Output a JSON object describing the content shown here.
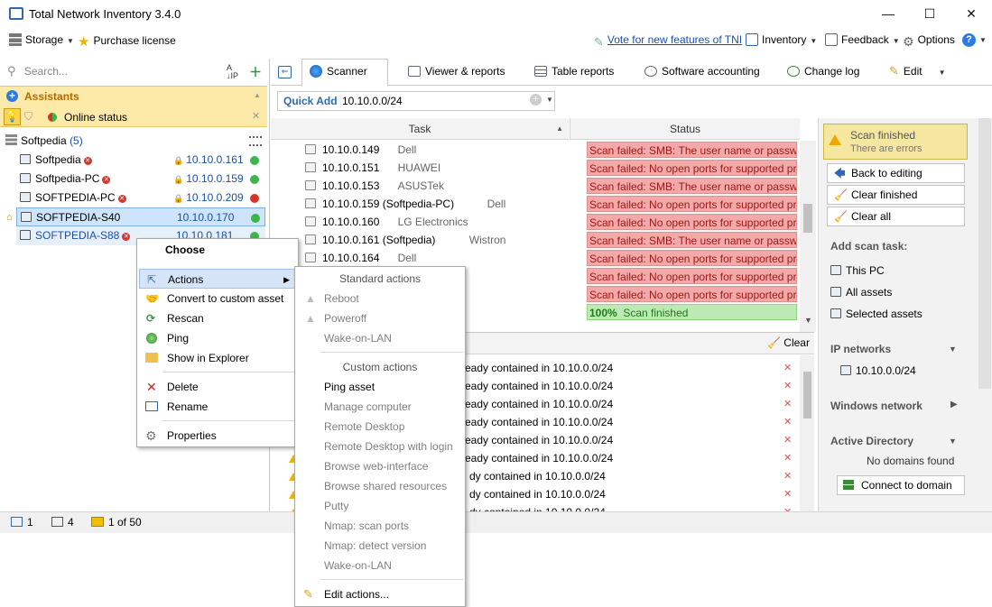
{
  "window": {
    "title": "Total Network Inventory 3.4.0",
    "min": "—",
    "max": "☐",
    "close": "✕"
  },
  "menu": {
    "storage": "Storage",
    "purchase": "Purchase license",
    "vote": "Vote for new features of TNI",
    "inventory": "Inventory",
    "feedback": "Feedback",
    "options": "Options",
    "help": "?"
  },
  "left": {
    "search_placeholder": "Search...",
    "assistants_title": "Assistants",
    "online_status": "Online status",
    "group": {
      "name": "Softpedia",
      "count": "(5)"
    },
    "hosts": [
      {
        "name": "Softpedia",
        "ip": "10.10.0.161",
        "color": "#3cb54a"
      },
      {
        "name": "Softpedia-PC",
        "ip": "10.10.0.159",
        "color": "#3cb54a"
      },
      {
        "name": "SOFTPEDIA-PC",
        "ip": "10.10.0.209",
        "color": "#d9342b"
      },
      {
        "name": "SOFTPEDIA-S40",
        "ip": "10.10.0.170",
        "color": "#3cb54a"
      },
      {
        "name": "SOFTPEDIA-S88",
        "ip": "10.10.0.181",
        "color": "#3cb54a"
      }
    ]
  },
  "tabs": {
    "scanner": "Scanner",
    "viewer": "Viewer & reports",
    "table": "Table reports",
    "software": "Software accounting",
    "changelog": "Change log",
    "edit": "Edit"
  },
  "quickadd": {
    "label": "Quick Add",
    "value": "10.10.0.0/24"
  },
  "grid": {
    "col_task": "Task",
    "col_status": "Status",
    "rows": [
      {
        "ip": "10.10.0.149",
        "vendor": "Dell",
        "status": "Scan failed: SMB: The user name or password is",
        "ok": false
      },
      {
        "ip": "10.10.0.151",
        "vendor": "HUAWEI",
        "status": "Scan failed: No open ports for supported protoc",
        "ok": false
      },
      {
        "ip": "10.10.0.153",
        "vendor": "ASUSTek",
        "status": "Scan failed: SMB: The user name or password is",
        "ok": false
      },
      {
        "ip": "10.10.0.159 (Softpedia-PC)",
        "vendor": "Dell",
        "status": "Scan failed: No open ports for supported protoc",
        "ok": false
      },
      {
        "ip": "10.10.0.160",
        "vendor": "LG Electronics",
        "status": "Scan failed: No open ports for supported protoc",
        "ok": false
      },
      {
        "ip": "10.10.0.161 (Softpedia)",
        "vendor": "Wistron",
        "status": "Scan failed: SMB: The user name or password is",
        "ok": false
      },
      {
        "ip": "10.10.0.164",
        "vendor": "Dell",
        "status": "Scan failed: No open ports for supported protoc",
        "ok": false
      },
      {
        "ip": "",
        "vendor": "",
        "status": "Scan failed: No open ports for supported protoc",
        "ok": false
      },
      {
        "ip": "",
        "vendor": "",
        "status": "Scan failed: No open ports for supported protoc",
        "ok": false
      },
      {
        "ip": "",
        "vendor": "",
        "status": "Scan finished",
        "pct": "100%",
        "ok": true
      }
    ]
  },
  "lower": {
    "clear": "Clear",
    "messages": [
      "eady contained in 10.10.0.0/24",
      "eady contained in 10.10.0.0/24",
      "eady contained in 10.10.0.0/24",
      "eady contained in 10.10.0.0/24",
      "eady contained in 10.10.0.0/24",
      "eady contained in 10.10.0.0/24",
      "dy contained in 10.10.0.0/24",
      "dy contained in 10.10.0.0/24",
      "dy contained in 10.10.0.0/24"
    ]
  },
  "right": {
    "scan_title": "Scan finished",
    "scan_sub": "There are errors",
    "back": "Back to editing",
    "clear_finished": "Clear finished",
    "clear_all": "Clear all",
    "add_scan": "Add scan task:",
    "this_pc": "This PC",
    "all_assets": "All assets",
    "selected_assets": "Selected assets",
    "ip_networks": "IP networks",
    "net": "10.10.0.0/24",
    "windows_network": "Windows network",
    "active_directory": "Active Directory",
    "no_domains": "No domains found",
    "connect": "Connect to domain"
  },
  "statusbar": {
    "a": "1",
    "b": "4",
    "c": "1 of 50"
  },
  "ctx1": {
    "title": "Choose",
    "actions": "Actions",
    "convert": "Convert to custom asset",
    "rescan": "Rescan",
    "ping": "Ping",
    "explorer": "Show in Explorer",
    "delete": "Delete",
    "rename": "Rename",
    "properties": "Properties"
  },
  "ctx2": {
    "standard": "Standard actions",
    "reboot": "Reboot",
    "poweroff": "Poweroff",
    "wol1": "Wake-on-LAN",
    "custom": "Custom actions",
    "ping": "Ping asset",
    "manage": "Manage computer",
    "rdp": "Remote Desktop",
    "rdp_login": "Remote Desktop with login",
    "browse_web": "Browse web-interface",
    "browse_shared": "Browse shared resources",
    "putty": "Putty",
    "nmap_ports": "Nmap: scan ports",
    "nmap_version": "Nmap: detect version",
    "wol2": "Wake-on-LAN",
    "edit": "Edit actions..."
  }
}
